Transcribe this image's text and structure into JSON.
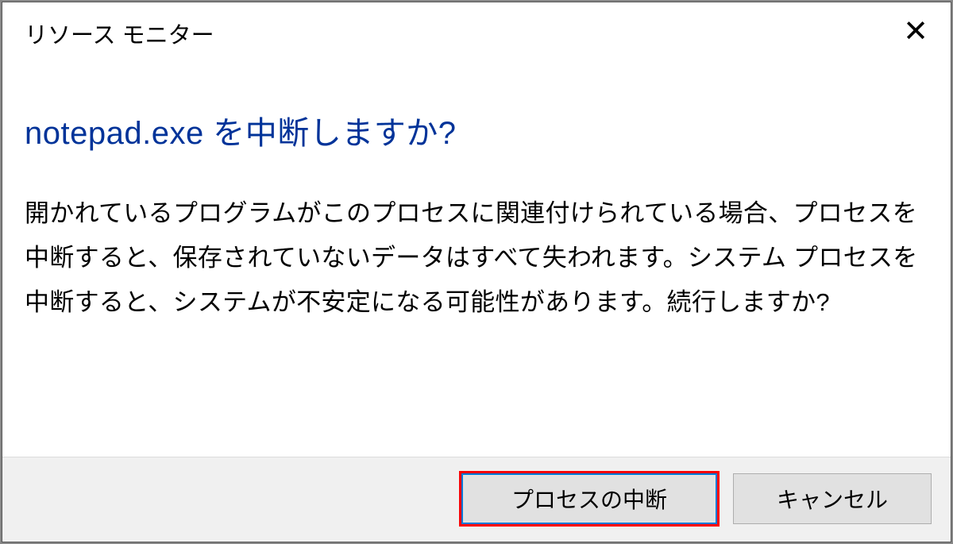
{
  "dialog": {
    "title": "リソース モニター",
    "heading": "notepad.exe を中断しますか?",
    "body": "開かれているプログラムがこのプロセスに関連付けられている場合、プロセスを中断すると、保存されていないデータはすべて失われます。システム プロセスを中断すると、システムが不安定になる可能性があります。続行しますか?",
    "buttons": {
      "primary": "プロセスの中断",
      "cancel": "キャンセル"
    }
  }
}
